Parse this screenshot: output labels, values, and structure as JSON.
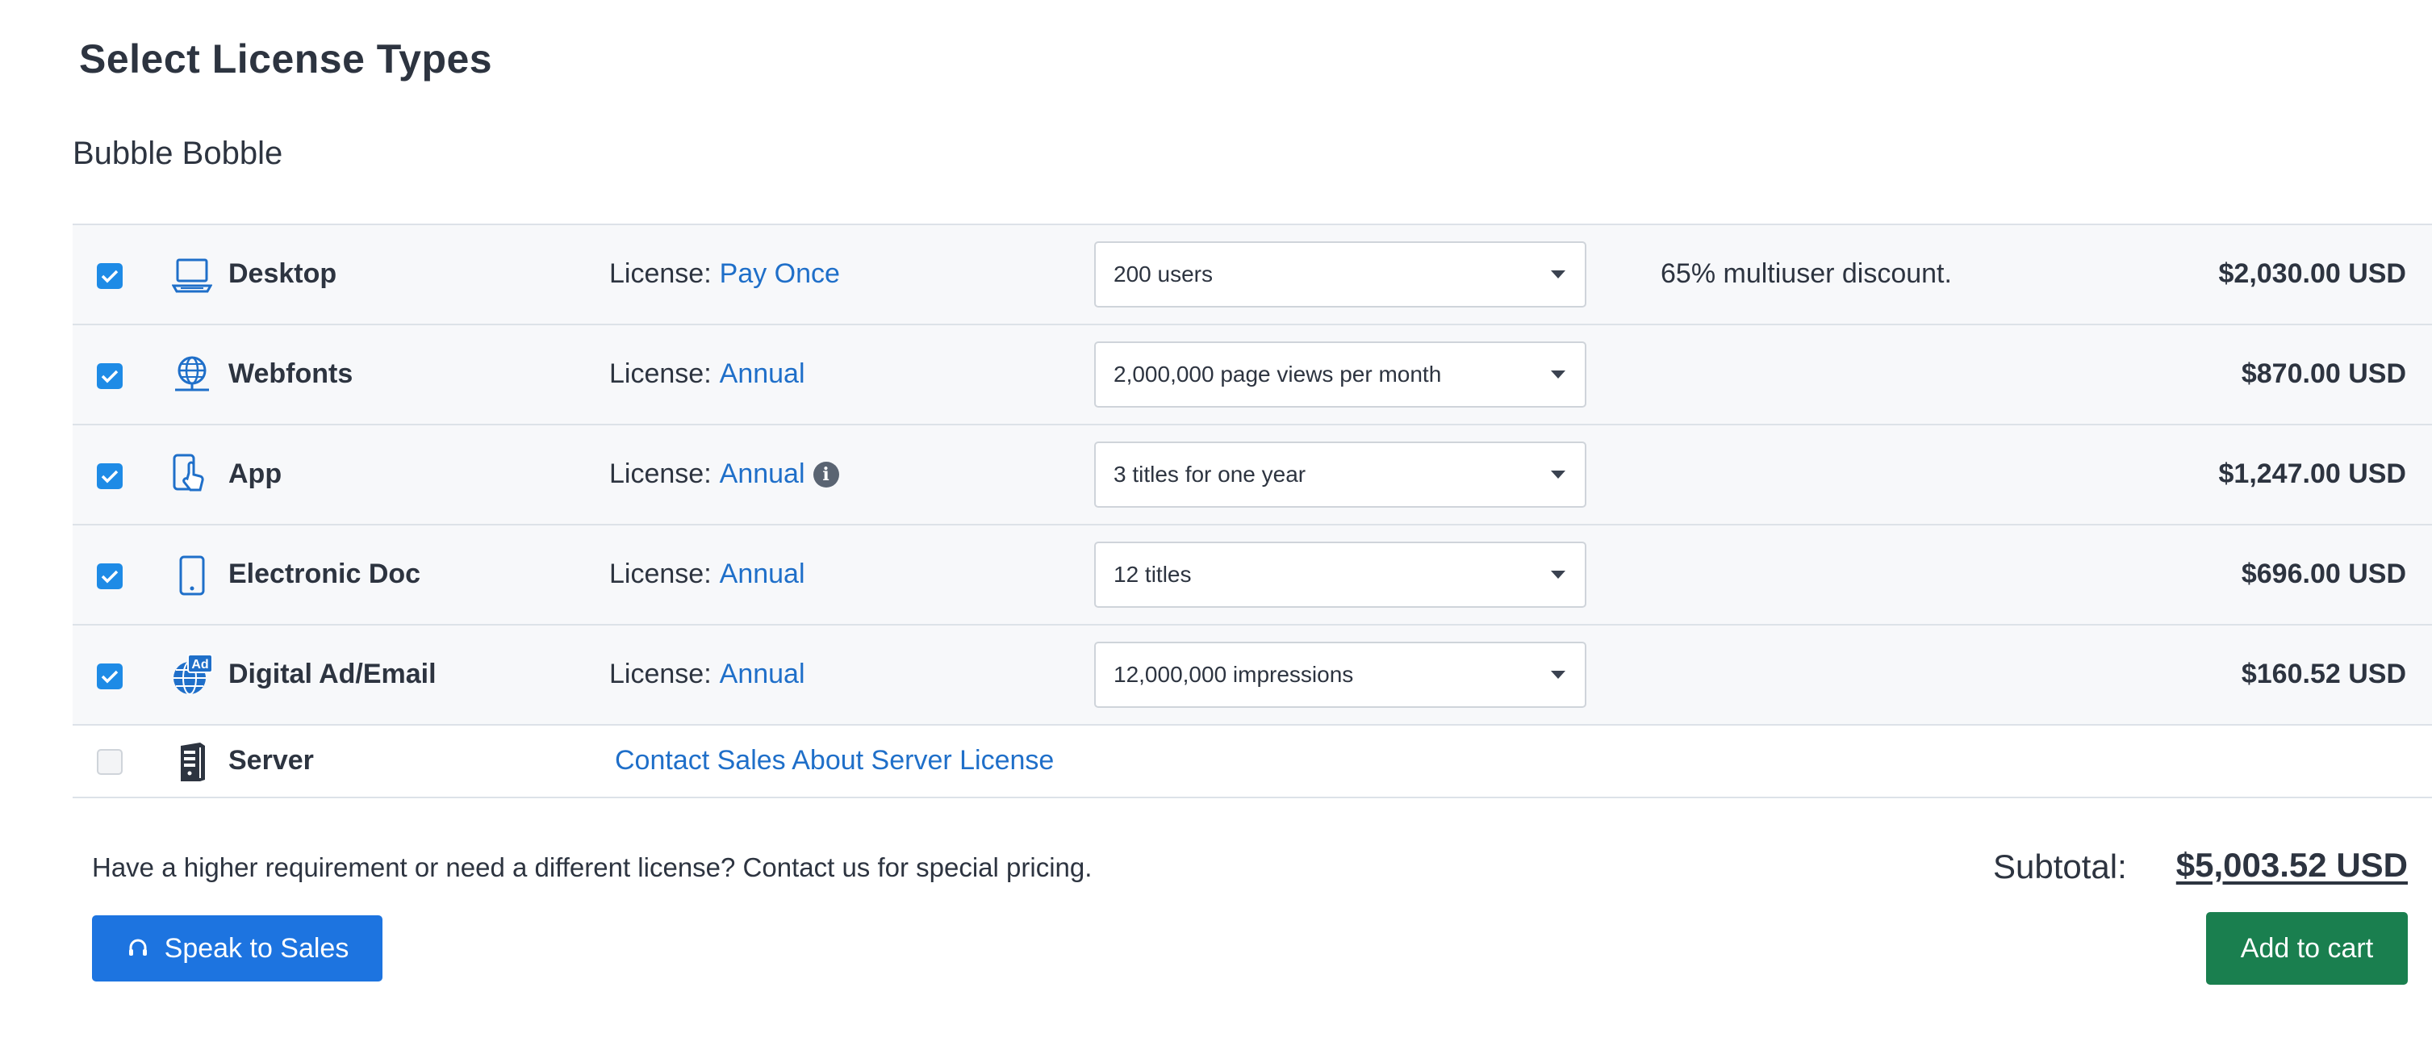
{
  "page": {
    "title": "Select License Types",
    "product_name": "Bubble Bobble"
  },
  "license_prefix": "License:",
  "rows": [
    {
      "type": "Desktop",
      "icon": "laptop-icon",
      "checked": true,
      "license_kind": "Pay Once",
      "has_info": false,
      "option": "200 users",
      "note": "65% multiuser discount.",
      "price": "$2,030.00 USD"
    },
    {
      "type": "Webfonts",
      "icon": "globe-icon",
      "checked": true,
      "license_kind": "Annual",
      "has_info": false,
      "option": "2,000,000 page views per month",
      "note": "",
      "price": "$870.00 USD"
    },
    {
      "type": "App",
      "icon": "phone-touch-icon",
      "checked": true,
      "license_kind": "Annual",
      "has_info": true,
      "option": "3 titles for one year",
      "note": "",
      "price": "$1,247.00 USD"
    },
    {
      "type": "Electronic Doc",
      "icon": "tablet-icon",
      "checked": true,
      "license_kind": "Annual",
      "has_info": false,
      "option": "12 titles",
      "note": "",
      "price": "$696.00 USD"
    },
    {
      "type": "Digital Ad/Email",
      "icon": "ad-globe-icon",
      "checked": true,
      "license_kind": "Annual",
      "has_info": false,
      "option": "12,000,000 impressions",
      "note": "",
      "price": "$160.52 USD"
    }
  ],
  "server": {
    "type": "Server",
    "icon": "server-icon",
    "checked": false,
    "contact_link": "Contact Sales About Server License"
  },
  "info_glyph": "i",
  "ad_badge": "Ad",
  "footer": {
    "note": "Have a higher requirement or need a different license? Contact us for special pricing.",
    "subtotal_label": "Subtotal:",
    "subtotal_value": "$5,003.52 USD",
    "speak_to_sales": "Speak to Sales",
    "add_to_cart": "Add to cart"
  },
  "colors": {
    "accent_blue": "#1e8be6",
    "link_blue": "#1f6fc9",
    "button_blue": "#1d74e0",
    "cart_green": "#1a7f4f",
    "text": "#2d3440"
  }
}
